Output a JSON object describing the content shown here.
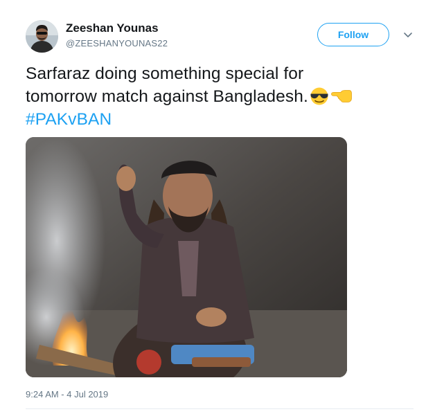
{
  "author": {
    "name": "Zeeshan Younas",
    "handle": "@ZEESHANYOUNAS22",
    "avatar_icon": "profile-photo"
  },
  "actions": {
    "follow_label": "Follow",
    "more_icon": "chevron-down-icon"
  },
  "tweet": {
    "line1": "Sarfaraz doing something special for",
    "line2": "tomorrow match against Bangladesh.",
    "emojis": [
      "smiling-face-with-sunglasses",
      "backhand-index-pointing-left"
    ],
    "hashtag": "#PAKvBAN",
    "timestamp": "9:24 AM - 4 Jul 2019"
  },
  "media": {
    "type": "photo"
  },
  "colors": {
    "accent": "#1da1f2",
    "text": "#14171a",
    "muted": "#657786",
    "divider": "#e6ecf0"
  }
}
